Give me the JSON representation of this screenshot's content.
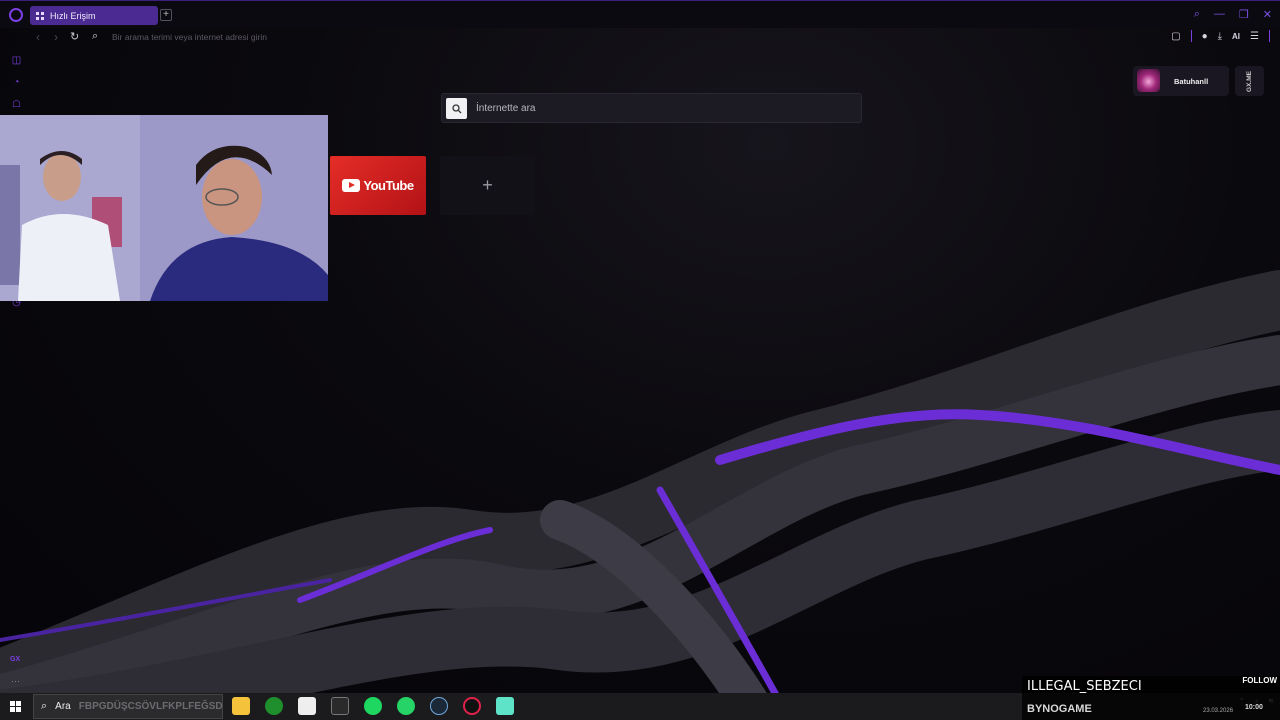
{
  "tab": {
    "label": "Hızlı Erişim"
  },
  "address_bar": {
    "placeholder": "Bir arama terimi veya internet adresi girin"
  },
  "toolbar": {
    "ai_label": "AI"
  },
  "search": {
    "placeholder": "İnternette ara"
  },
  "speed_dials": [
    {
      "name": "YouTube",
      "logo_text": "YouTube"
    },
    {
      "name": "add",
      "symbol": "+"
    }
  ],
  "profile": {
    "name": "Batuhanll",
    "gx_label": "GX.ME"
  },
  "sidebar": {
    "gx_label": "GX",
    "more": "···"
  },
  "taskbar": {
    "search_label": "Ara",
    "search_ghost": "FBPGDÜŞCSÖVLFKPLFEĞSD",
    "apps": [
      "file-explorer",
      "xbox",
      "acrobat",
      "epic-games",
      "spotify",
      "whatsapp",
      "steam",
      "opera-gx",
      "unknown-app"
    ]
  },
  "stream_overlay": {
    "streamer": "ILLEGAL_SEBZECI",
    "follow": "FOLLOW",
    "channel": "BYNOGAME",
    "date": "23.03.2026",
    "time": "10:00"
  },
  "colors": {
    "accent": "#7b3fe4",
    "tab_bg": "#4b2a92",
    "youtube_red": "#e52d27"
  }
}
